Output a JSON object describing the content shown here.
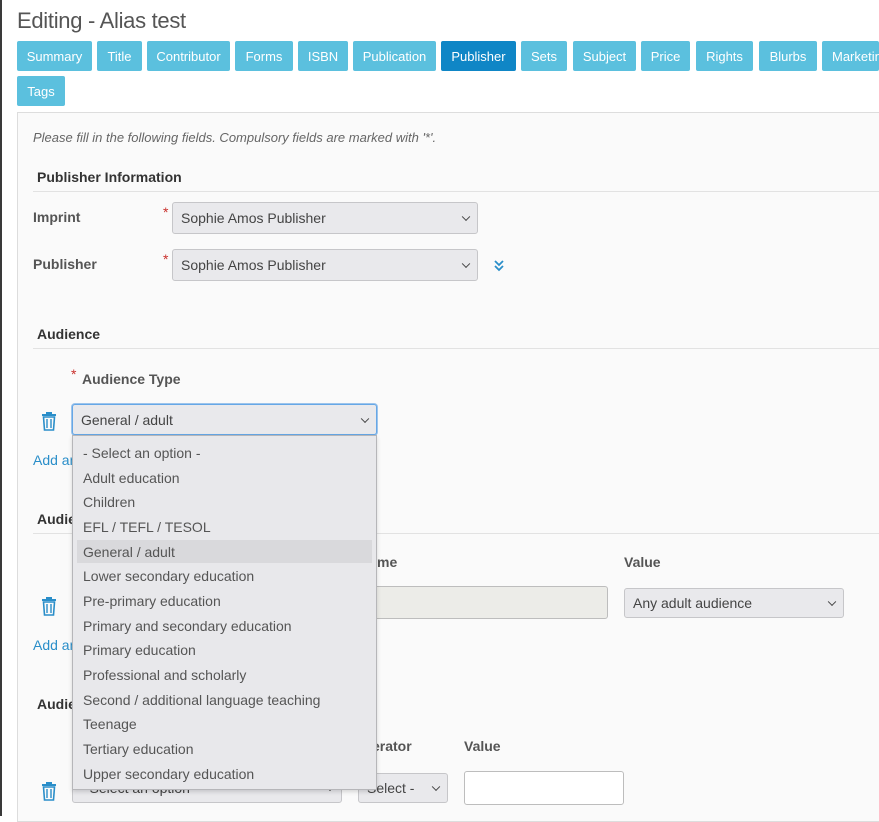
{
  "page": {
    "title": "Editing - Alias test"
  },
  "tabs": [
    {
      "label": "Summary"
    },
    {
      "label": "Title"
    },
    {
      "label": "Contributor"
    },
    {
      "label": "Forms"
    },
    {
      "label": "ISBN"
    },
    {
      "label": "Publication"
    },
    {
      "label": "Publisher",
      "active": true
    },
    {
      "label": "Sets"
    },
    {
      "label": "Subject"
    },
    {
      "label": "Price"
    },
    {
      "label": "Rights"
    },
    {
      "label": "Blurbs"
    },
    {
      "label": "Marketin"
    },
    {
      "label": "Tags"
    }
  ],
  "form": {
    "instructions": "Please fill in the following fields. Compulsory fields are marked with '*'.",
    "required_marker": "*",
    "publisher_info": {
      "heading": "Publisher Information",
      "imprint": {
        "label": "Imprint",
        "value": "Sophie Amos Publisher"
      },
      "publisher": {
        "label": "Publisher",
        "value": "Sophie Amos Publisher"
      },
      "expand_icon": "double-chevron-down-icon"
    },
    "audience": {
      "heading": "Audience",
      "type_label": "Audience Type",
      "type_value": "General / adult",
      "add_link": "Add an"
    },
    "audience_code": {
      "heading": "Audie",
      "name_label": "me",
      "value_label": "Value",
      "value_select": "Any adult audience",
      "add_link": "Add an"
    },
    "audience_range": {
      "heading": "Audie",
      "operator_label": "erator",
      "value_label": "Value",
      "qualifier_select": "- Select an option -",
      "operator_select": "Select -"
    }
  },
  "dropdown": {
    "options": [
      "- Select an option -",
      "Adult education",
      "Children",
      "EFL / TEFL / TESOL",
      "General / adult",
      "Lower secondary education",
      "Pre-primary education",
      "Primary and secondary education",
      "Primary education",
      "Professional and scholarly",
      "Second / additional language teaching",
      "Teenage",
      "Tertiary education",
      "Upper secondary education"
    ],
    "selected": "General / adult"
  },
  "colors": {
    "tab": "#5bc0de",
    "tab_active": "#0f86c6",
    "link": "#2a8ec9",
    "required": "#c9302c"
  }
}
